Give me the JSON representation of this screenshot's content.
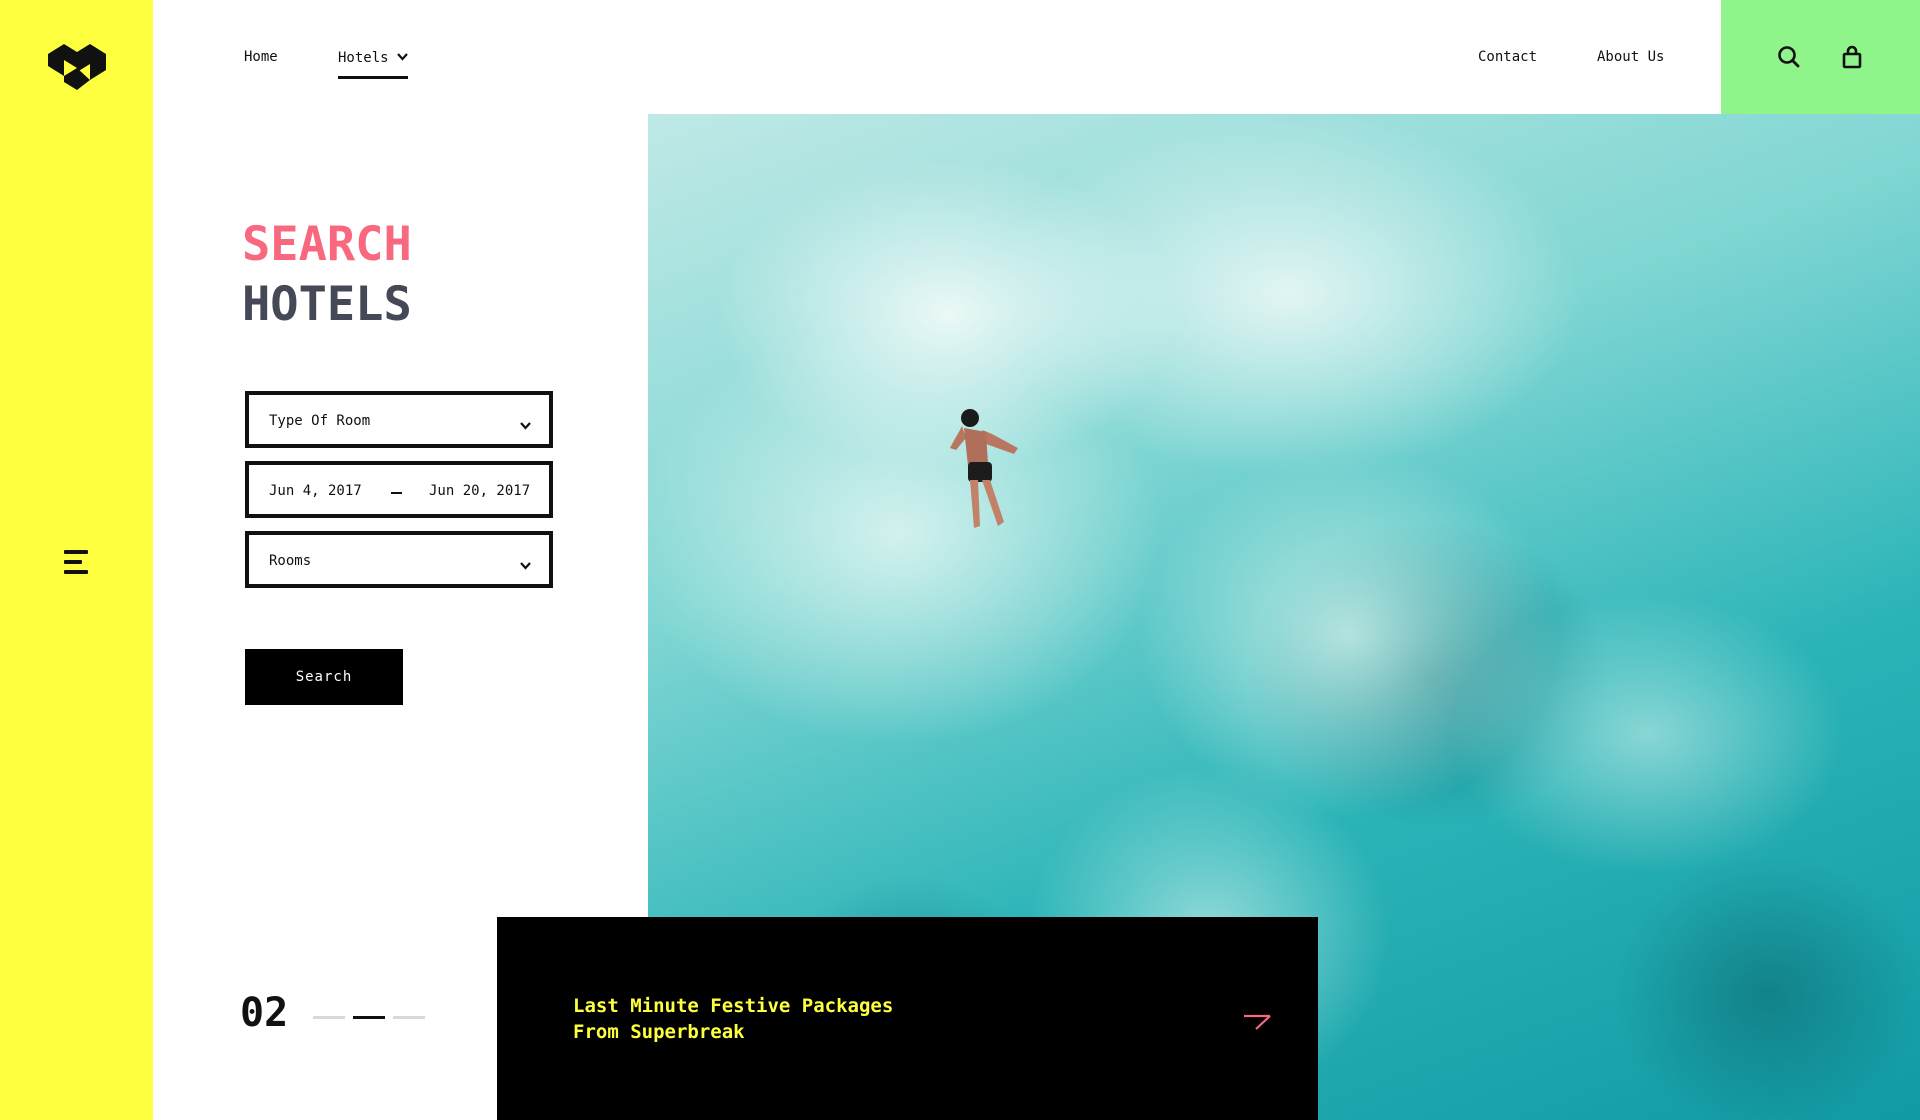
{
  "nav": {
    "home": "Home",
    "hotels": "Hotels",
    "contact": "Contact",
    "about": "About Us"
  },
  "hero": {
    "title_line1": "SEARCH",
    "title_line2": "HOTELS"
  },
  "form": {
    "room_type_placeholder": "Type Of Room",
    "date_start": "Jun 4, 2017",
    "date_end": "Jun 20, 2017",
    "rooms_placeholder": "Rooms",
    "search_label": "Search"
  },
  "slider": {
    "current": "02",
    "total_slides": 3,
    "active_index": 1
  },
  "promo": {
    "line1": "Last Minute Festive Packages",
    "line2": "From Superbreak"
  },
  "colors": {
    "sidebar": "#fdff3f",
    "utility": "#8ff58a",
    "accent_pink": "#f8697f",
    "heading_dark": "#454857",
    "promo_text": "#fdff3f"
  },
  "icons": [
    "logo-icon",
    "menu-icon",
    "chevron-down-icon",
    "search-icon",
    "bag-icon",
    "arrow-right-icon"
  ]
}
